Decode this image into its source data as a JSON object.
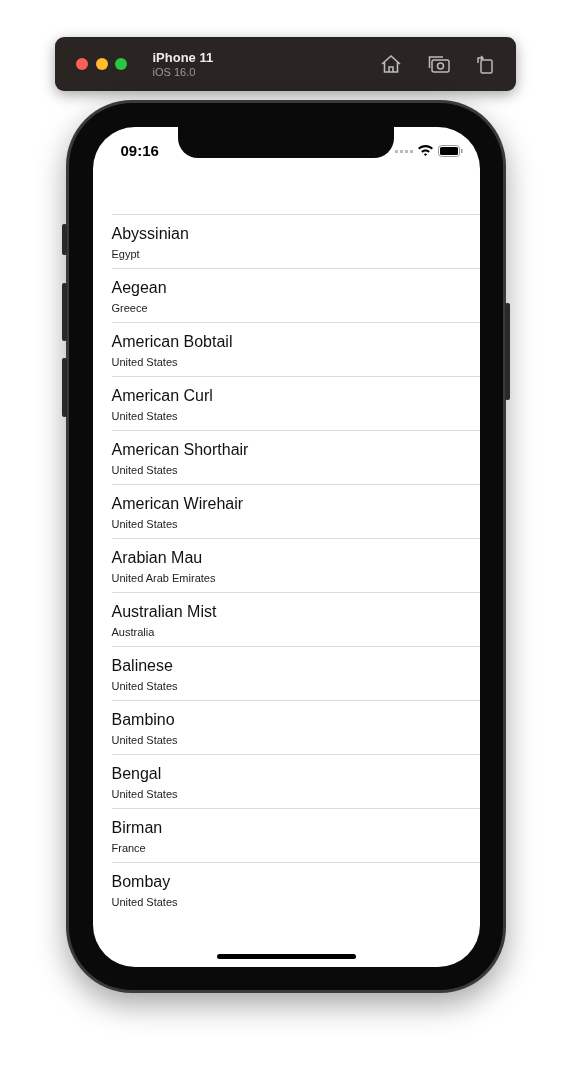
{
  "simulator_toolbar": {
    "device_name": "iPhone 11",
    "os_version": "iOS 16.0"
  },
  "status_bar": {
    "time": "09:16"
  },
  "rows": [
    {
      "title": "Abyssinian",
      "subtitle": "Egypt"
    },
    {
      "title": "Aegean",
      "subtitle": "Greece"
    },
    {
      "title": "American Bobtail",
      "subtitle": "United States"
    },
    {
      "title": "American Curl",
      "subtitle": "United States"
    },
    {
      "title": "American Shorthair",
      "subtitle": "United States"
    },
    {
      "title": "American Wirehair",
      "subtitle": "United States"
    },
    {
      "title": "Arabian Mau",
      "subtitle": "United Arab Emirates"
    },
    {
      "title": "Australian Mist",
      "subtitle": "Australia"
    },
    {
      "title": "Balinese",
      "subtitle": "United States"
    },
    {
      "title": "Bambino",
      "subtitle": "United States"
    },
    {
      "title": "Bengal",
      "subtitle": "United States"
    },
    {
      "title": "Birman",
      "subtitle": "France"
    },
    {
      "title": "Bombay",
      "subtitle": "United States"
    }
  ]
}
